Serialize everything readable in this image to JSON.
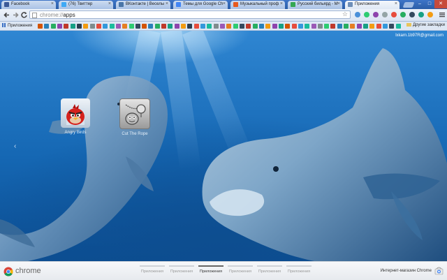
{
  "tabs": [
    {
      "title": "Facebook",
      "favicon_color": "#3b5998"
    },
    {
      "title": "(76) Твиттер",
      "favicon_color": "#3fa9f5"
    },
    {
      "title": "ВКонтакте | Веселы",
      "favicon_color": "#4a76a8"
    },
    {
      "title": "Темы для Google Ch",
      "favicon_color": "#4285f4"
    },
    {
      "title": "Музыкальный проф",
      "favicon_color": "#e85a1e"
    },
    {
      "title": "Русский бильярд - М",
      "favicon_color": "#34a853"
    },
    {
      "title": "Приложения",
      "favicon_color": "#6f8fb8",
      "active": true
    }
  ],
  "window_controls": {
    "minimize": "–",
    "maximize": "□",
    "close": "✕"
  },
  "toolbar": {
    "back_icon": "arrow-left-icon",
    "forward_icon": "arrow-right-icon",
    "reload_icon": "reload-icon",
    "url_scheme": "chrome://",
    "url_path": "apps",
    "bookmark_star": "☆",
    "menu_icon": "wrench-icon",
    "extension_colors": [
      "#4a90d9",
      "#2ecc71",
      "#8e44ad",
      "#95a5a6",
      "#e74c3c",
      "#27ae60",
      "#34495e",
      "#16a085",
      "#f39c12"
    ]
  },
  "bookmarks_bar": {
    "apps_label": "Приложения",
    "other_label": "Другие закладки",
    "bookmark_colors": [
      "#d35400",
      "#2980b9",
      "#27ae60",
      "#8e44ad",
      "#c0392b",
      "#16a085",
      "#2c3e50",
      "#f39c12",
      "#7f8c8d",
      "#e74c3c",
      "#3498db",
      "#1abc9c",
      "#9b59b6",
      "#e67e22",
      "#2ecc71",
      "#34495e",
      "#d35400",
      "#2980b9",
      "#27ae60",
      "#c0392b",
      "#16a085",
      "#8e44ad",
      "#f39c12",
      "#2c3e50",
      "#e74c3c",
      "#3498db",
      "#1abc9c",
      "#7f8c8d",
      "#9b59b6",
      "#e67e22",
      "#2ecc71",
      "#34495e",
      "#c0392b",
      "#27ae60",
      "#2980b9",
      "#f39c12",
      "#8e44ad",
      "#16a085",
      "#d35400",
      "#e74c3c",
      "#3498db",
      "#1abc9c",
      "#9b59b6",
      "#7f8c8d",
      "#2ecc71",
      "#c0392b",
      "#2980b9",
      "#27ae60",
      "#e67e22",
      "#8e44ad",
      "#16a085",
      "#f39c12",
      "#e74c3c",
      "#3498db",
      "#34495e",
      "#1abc9c"
    ]
  },
  "user_email": "lxkarn.1b97R@gmail.com",
  "apps": [
    {
      "name": "Angry Birds",
      "icon": "angry-birds-icon"
    },
    {
      "name": "Cut The Rope",
      "icon": "cut-the-rope-icon"
    }
  ],
  "footer": {
    "brand": "chrome",
    "pages": [
      "Приложения",
      "Приложения",
      "Приложения",
      "Приложения",
      "Приложения",
      "Приложения"
    ],
    "current_page": 2,
    "store_label": "Интернет-магазин Chrome",
    "store_icon": "web-store-icon"
  }
}
